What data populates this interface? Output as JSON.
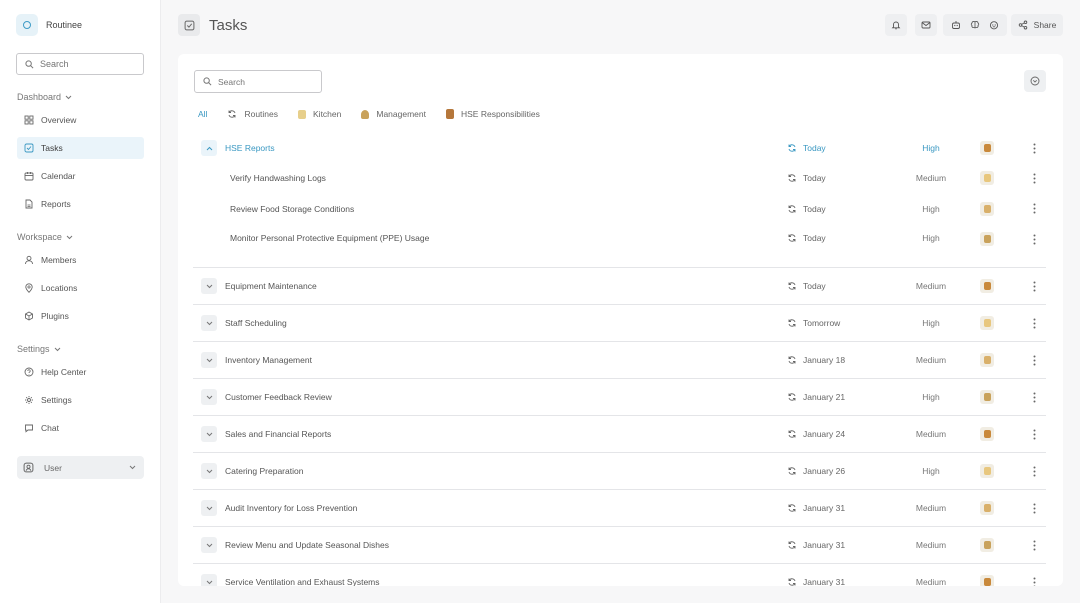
{
  "app": {
    "name": "Routinee"
  },
  "sidebar": {
    "search_placeholder": "Search",
    "sections": [
      {
        "title": "Dashboard",
        "items": [
          {
            "label": "Overview",
            "icon": "grid-icon"
          },
          {
            "label": "Tasks",
            "icon": "checkbox-icon",
            "active": true
          },
          {
            "label": "Calendar",
            "icon": "calendar-icon"
          },
          {
            "label": "Reports",
            "icon": "report-icon"
          }
        ]
      },
      {
        "title": "Workspace",
        "items": [
          {
            "label": "Members",
            "icon": "person-icon"
          },
          {
            "label": "Locations",
            "icon": "location-pin-icon"
          },
          {
            "label": "Plugins",
            "icon": "plugin-icon"
          }
        ]
      },
      {
        "title": "Settings",
        "items": [
          {
            "label": "Help Center",
            "icon": "help-icon"
          },
          {
            "label": "Settings",
            "icon": "gear-icon"
          },
          {
            "label": "Chat",
            "icon": "chat-icon"
          }
        ]
      }
    ],
    "user_label": "User"
  },
  "header": {
    "title": "Tasks",
    "share_label": "Share"
  },
  "tasks": {
    "search_placeholder": "Search",
    "filters": [
      {
        "label": "All",
        "icon": ""
      },
      {
        "label": "Routines",
        "icon": "refresh-icon"
      },
      {
        "label": "Kitchen",
        "icon": "kitchen-emoji-icon"
      },
      {
        "label": "Management",
        "icon": "management-emoji-icon"
      },
      {
        "label": "HSE Responsibilities",
        "icon": "hse-emoji-icon"
      }
    ],
    "rows": [
      {
        "name": "HSE Reports",
        "date": "Today",
        "priority": "High",
        "kind": "group"
      },
      {
        "name": "Verify Handwashing Logs",
        "date": "Today",
        "priority": "Medium",
        "kind": "sub"
      },
      {
        "name": "Review Food Storage Conditions",
        "date": "Today",
        "priority": "High",
        "kind": "sub"
      },
      {
        "name": "Monitor Personal Protective Equipment (PPE) Usage",
        "date": "Today",
        "priority": "High",
        "kind": "sub-end"
      },
      {
        "name": "Equipment Maintenance",
        "date": "Today",
        "priority": "Medium",
        "kind": "row"
      },
      {
        "name": "Staff Scheduling",
        "date": "Tomorrow",
        "priority": "High",
        "kind": "row"
      },
      {
        "name": "Inventory Management",
        "date": "January 18",
        "priority": "Medium",
        "kind": "row"
      },
      {
        "name": "Customer Feedback Review",
        "date": "January 21",
        "priority": "High",
        "kind": "row"
      },
      {
        "name": "Sales and Financial Reports",
        "date": "January 24",
        "priority": "Medium",
        "kind": "row"
      },
      {
        "name": "Catering Preparation",
        "date": "January 26",
        "priority": "High",
        "kind": "row"
      },
      {
        "name": "Audit Inventory for Loss Prevention",
        "date": "January 31",
        "priority": "Medium",
        "kind": "row"
      },
      {
        "name": "Review Menu and Update Seasonal Dishes",
        "date": "January 31",
        "priority": "Medium",
        "kind": "row"
      },
      {
        "name": "Service Ventilation and Exhaust Systems",
        "date": "January 31",
        "priority": "Medium",
        "kind": "row"
      }
    ]
  },
  "colors": {
    "accent": "#3a98c2",
    "accent_bg": "#eaf4fa",
    "text": "#555555"
  }
}
